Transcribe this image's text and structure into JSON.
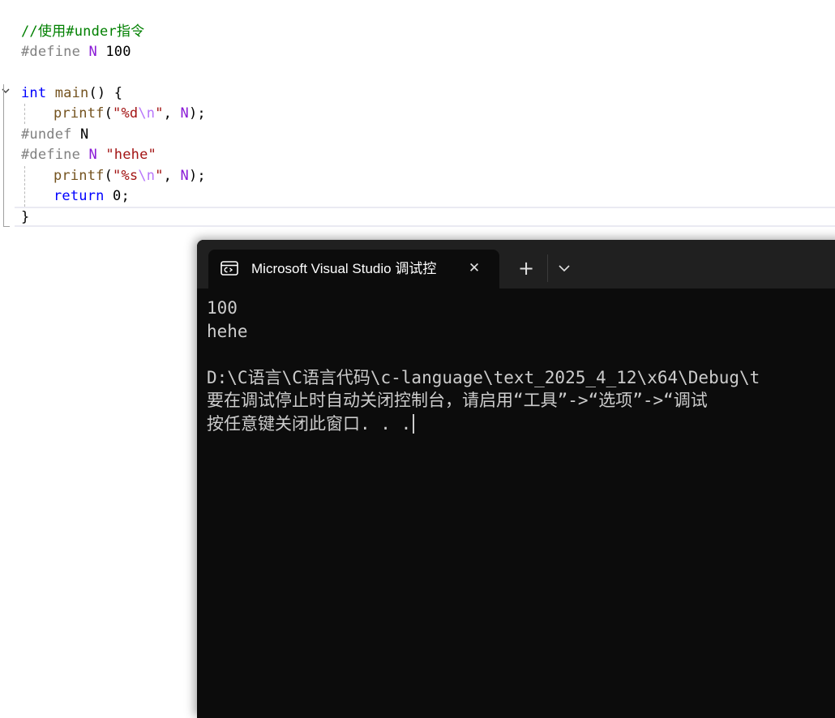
{
  "editor": {
    "lines": [
      {
        "tokens": [
          {
            "t": "//使用#under指令",
            "c": "comment"
          }
        ]
      },
      {
        "tokens": [
          {
            "t": "#define ",
            "c": "pre"
          },
          {
            "t": "N",
            "c": "macro"
          },
          {
            "t": " 100",
            "c": "num"
          }
        ]
      },
      {
        "tokens": []
      },
      {
        "tokens": [
          {
            "t": "int",
            "c": "type"
          },
          {
            "t": " ",
            "c": "plain"
          },
          {
            "t": "main",
            "c": "fn"
          },
          {
            "t": "() {",
            "c": "plain"
          }
        ]
      },
      {
        "indent": 1,
        "tokens": [
          {
            "t": "printf",
            "c": "fn"
          },
          {
            "t": "(",
            "c": "plain"
          },
          {
            "t": "\"%d",
            "c": "str"
          },
          {
            "t": "\\n",
            "c": "esc"
          },
          {
            "t": "\"",
            "c": "str"
          },
          {
            "t": ", ",
            "c": "plain"
          },
          {
            "t": "N",
            "c": "macro"
          },
          {
            "t": ");",
            "c": "plain"
          }
        ]
      },
      {
        "tokens": [
          {
            "t": "#undef ",
            "c": "pre"
          },
          {
            "t": "N",
            "c": "plain"
          }
        ]
      },
      {
        "tokens": [
          {
            "t": "#define ",
            "c": "pre"
          },
          {
            "t": "N",
            "c": "macro"
          },
          {
            "t": " ",
            "c": "plain"
          },
          {
            "t": "\"hehe\"",
            "c": "str"
          }
        ]
      },
      {
        "indent": 1,
        "tokens": [
          {
            "t": "printf",
            "c": "fn"
          },
          {
            "t": "(",
            "c": "plain"
          },
          {
            "t": "\"%s",
            "c": "str"
          },
          {
            "t": "\\n",
            "c": "esc"
          },
          {
            "t": "\"",
            "c": "str"
          },
          {
            "t": ", ",
            "c": "plain"
          },
          {
            "t": "N",
            "c": "macro"
          },
          {
            "t": ");",
            "c": "plain"
          }
        ]
      },
      {
        "indent": 1,
        "tokens": [
          {
            "t": "return",
            "c": "kw"
          },
          {
            "t": " 0;",
            "c": "plain"
          }
        ]
      },
      {
        "tokens": [
          {
            "t": "}",
            "c": "plain"
          }
        ]
      }
    ]
  },
  "terminal": {
    "tab_title": "Microsoft Visual Studio 调试控",
    "close_glyph": "✕",
    "new_tab_glyph": "+",
    "output_lines": [
      "100",
      "hehe",
      "",
      "D:\\C语言\\C语言代码\\c-language\\text_2025_4_12\\x64\\Debug\\t",
      "要在调试停止时自动关闭控制台，请启用“工具”->“选项”->“调试",
      "按任意键关闭此窗口. . ."
    ]
  },
  "colors": {
    "comment": "#008000",
    "keyword": "#0000ff",
    "macro": "#8a1bd6",
    "string": "#a31515",
    "escape": "#b776fb",
    "function": "#74531f",
    "preprocessor": "#808080",
    "terminal_bg": "#0c0c0c",
    "terminal_text": "#cccccc"
  },
  "icons": {
    "fold": "chevron-down-icon",
    "tab": "console-icon",
    "close": "close-icon",
    "new_tab": "plus-icon",
    "dropdown": "chevron-down-icon"
  }
}
